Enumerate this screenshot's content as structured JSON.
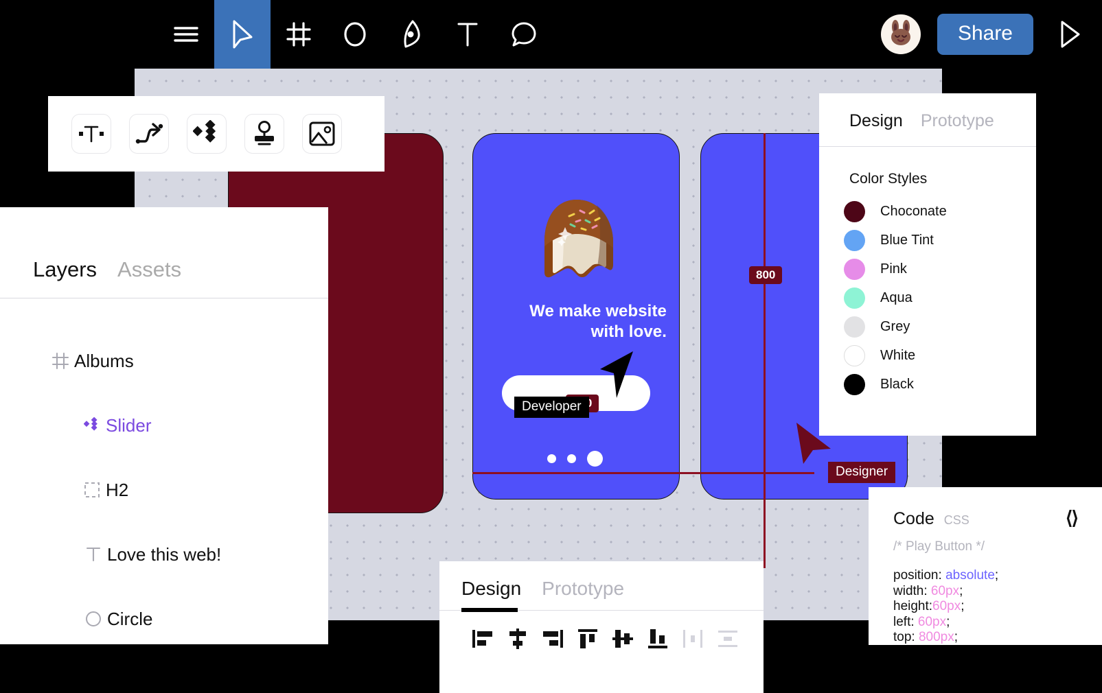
{
  "topbar": {
    "tools": [
      {
        "name": "menu-icon",
        "label": "Menu"
      },
      {
        "name": "cursor-icon",
        "label": "Move"
      },
      {
        "name": "frame-icon",
        "label": "Frame"
      },
      {
        "name": "ellipse-icon",
        "label": "Ellipse"
      },
      {
        "name": "pen-icon",
        "label": "Pen"
      },
      {
        "name": "text-icon",
        "label": "Text"
      },
      {
        "name": "comment-icon",
        "label": "Comment"
      }
    ],
    "active_tool": "cursor-icon",
    "avatar_name": "bunny-avatar",
    "share_label": "Share",
    "present_label": "Present"
  },
  "insert_bar": {
    "items": [
      {
        "name": "text-box-icon",
        "label": "Text box"
      },
      {
        "name": "connector-icon",
        "label": "Connector"
      },
      {
        "name": "component-icon",
        "label": "Component"
      },
      {
        "name": "stamp-icon",
        "label": "Stamp"
      },
      {
        "name": "image-icon",
        "label": "Image"
      }
    ]
  },
  "layers_panel": {
    "tabs": [
      {
        "label": "Layers",
        "active": true
      },
      {
        "label": "Assets",
        "active": false
      }
    ],
    "items": [
      {
        "label": "Albums",
        "icon": "frame-icon",
        "level": 0,
        "selected": false
      },
      {
        "label": "Slider",
        "icon": "component-icon",
        "level": 1,
        "selected": true
      },
      {
        "label": "H2",
        "icon": "group-icon",
        "level": 1,
        "selected": false
      },
      {
        "label": "Love this web!",
        "icon": "text-icon",
        "level": 2,
        "selected": false
      },
      {
        "label": "Circle",
        "icon": "ellipse-icon",
        "level": 2,
        "selected": false
      }
    ]
  },
  "design_panel": {
    "tabs": [
      {
        "label": "Design",
        "active": true
      },
      {
        "label": "Prototype",
        "active": false
      }
    ],
    "section_title": "Color Styles",
    "color_styles": [
      {
        "label": "Choconate",
        "color": "#4d0617"
      },
      {
        "label": "Blue Tint",
        "color": "#63a4f4"
      },
      {
        "label": "Pink",
        "color": "#e68ce8"
      },
      {
        "label": "Aqua",
        "color": "#8ef3d5"
      },
      {
        "label": "Grey",
        "color": "#e2e2e4"
      },
      {
        "label": "White",
        "color": "#ffffff"
      },
      {
        "label": "Black",
        "color": "#000000"
      }
    ]
  },
  "bottom_panel": {
    "tabs": [
      {
        "label": "Design",
        "active": true
      },
      {
        "label": "Prototype",
        "active": false
      }
    ],
    "align_tools": [
      {
        "name": "align-left-icon",
        "label": "Align left",
        "disabled": false
      },
      {
        "name": "align-horizontal-center-icon",
        "label": "Align horizontal centers",
        "disabled": false
      },
      {
        "name": "align-right-icon",
        "label": "Align right",
        "disabled": false
      },
      {
        "name": "align-top-icon",
        "label": "Align top",
        "disabled": false
      },
      {
        "name": "align-vertical-center-icon",
        "label": "Align vertical centers",
        "disabled": false
      },
      {
        "name": "align-bottom-icon",
        "label": "Align bottom",
        "disabled": false
      },
      {
        "name": "distribute-horizontal-icon",
        "label": "Distribute horizontal spacing",
        "disabled": true
      },
      {
        "name": "distribute-vertical-icon",
        "label": "Distribute vertical spacing",
        "disabled": true
      }
    ]
  },
  "code_panel": {
    "title": "Code",
    "language": "CSS",
    "toggle_icon": "code-chevrons-icon",
    "comment": "/* Play Button */",
    "declarations": [
      {
        "prop": "position:",
        "value": "absolute",
        "value_kind": "keyword",
        "semicolon": ";",
        "space": " "
      },
      {
        "prop": "width:",
        "value": "60px",
        "value_kind": "number",
        "semicolon": ";",
        "space": " "
      },
      {
        "prop": "height:",
        "value": "60px",
        "value_kind": "number",
        "semicolon": ";",
        "space": ""
      },
      {
        "prop": "left:",
        "value": "60px",
        "value_kind": "number",
        "semicolon": ";",
        "space": " "
      },
      {
        "prop": "top:",
        "value": "800px",
        "value_kind": "number",
        "semicolon": ";",
        "space": " "
      }
    ]
  },
  "canvas": {
    "frames": [
      {
        "name": "frame-albums",
        "color": "#6b0a1c"
      },
      {
        "name": "frame-slider",
        "color": "#5050fa"
      },
      {
        "name": "frame-third",
        "color": "#5050fa"
      }
    ],
    "hero_text_line1": "We make website",
    "hero_text_line2": "with love.",
    "measure_vertical": "800",
    "measure_horizontal": "600",
    "cursors": [
      {
        "label": "Developer",
        "color": "#000000"
      },
      {
        "label": "Designer",
        "color": "#6b0a1c"
      }
    ]
  }
}
